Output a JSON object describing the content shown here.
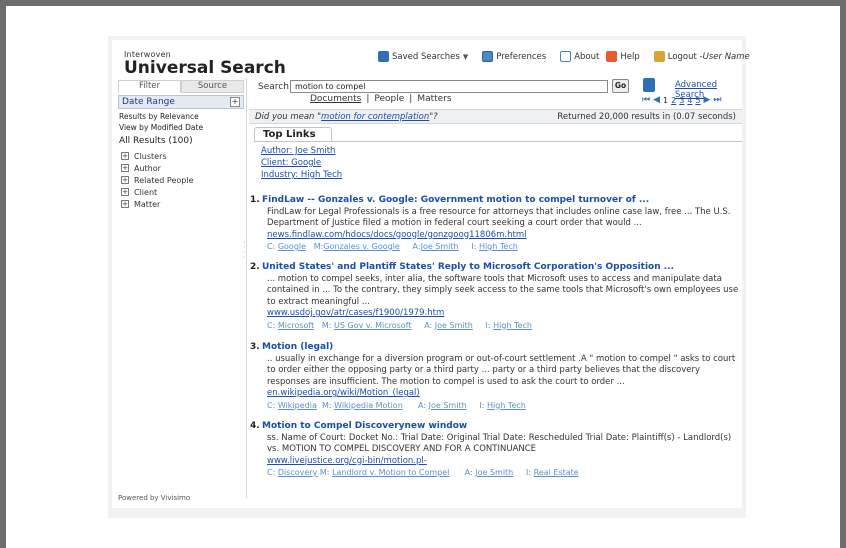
{
  "header": {
    "logo_small": "Interwoven",
    "logo_big": "Universal Search",
    "saved_searches": "Saved Searches",
    "preferences": "Preferences",
    "about": "About",
    "help": "Help",
    "logout": "Logout - ",
    "user_name": "User Name"
  },
  "sidebar": {
    "tabs": [
      "Filter",
      "Source"
    ],
    "date_range": "Date Range",
    "results_by_relevance": "Results by Relevance",
    "view_by_modified_date": "View by Modified Date",
    "all_results": "All Results (100)",
    "tree": [
      "Clusters",
      "Author",
      "Related People",
      "Client",
      "Matter"
    ],
    "powered_by": "Powered by Vivisimo"
  },
  "search": {
    "label": "Search:",
    "query": "motion to compel",
    "go": "Go",
    "advanced": "Advanced Search",
    "subtabs": [
      "Documents",
      "People",
      "Matters"
    ],
    "pages": [
      "1",
      "2",
      "3",
      "4",
      "5"
    ]
  },
  "didyoumean": {
    "prefix": "Did you mean \"",
    "suggestion": "motion for contemplation",
    "suffix": "\"?",
    "returned": "Returned 20,000 results in (0.07 seconds)"
  },
  "toplinks": {
    "title": "Top Links",
    "links": [
      "Author: Joe Smith",
      "Client: Google ",
      "Industry: High Tech"
    ]
  },
  "results": [
    {
      "num": "1.",
      "title": "FindLaw -- Gonzales v. Google: Government motion to compel turnover of ...",
      "desc": "FindLaw for Legal Professionals is a free resource for attorneys that includes online case law, free ... The U.S. Department of Justice filed a motion in federal court seeking a court order that would ...",
      "url": "news.findlaw.com/hdocs/docs/google/gonzgoog11806m.html",
      "client": "Google",
      "matter": "Gonzales v. Google",
      "author": "Joe Smith",
      "industry": "High Tech"
    },
    {
      "num": "2.",
      "title": "United States' and Plantiff States' Reply to Microsoft Corporation's Opposition ...",
      "desc": "... motion to compel seeks, inter alia, the software tools that Microsoft uses to access and manipulate data contained in ... To the contrary, they simply seek access to the same tools that Microsoft's own employees use to extract meaningful ...",
      "url": "www.usdoj.gov/atr/cases/f1900/1979.htm ",
      "client": "Microsoft",
      "matter": "US Gov v. Microsoft",
      "author": "Joe Smith",
      "industry": "High Tech"
    },
    {
      "num": "3.",
      "title": "Motion (legal)",
      "desc": ".. usually in exchange for a diversion program or out-of-court settlement .A \" motion to compel \" asks to court to order either the opposing party or a third party ... party or a third party believes that the discovery responses are insufficient. The motion to compel is used to ask the court to order ...",
      "url": "en.wikipedia.org/wiki/Motion_(legal)",
      "client": "Wikipedia",
      "matter": "Wikipedia Motion",
      "author": "Joe Smith",
      "industry": "High Tech"
    },
    {
      "num": "4.",
      "title": "Motion to Compel Discoverynew window",
      "desc": "ss. Name of Court: Docket No.: Trial Date: Original Trial Date: Rescheduled Trial Date: Plaintiff(s) - Landlord(s) vs. MOTION TO COMPEL DISCOVERY AND FOR A CONTINUANCE",
      "url": "www.livejustice.org/cgi-bin/motion.pl-",
      "client": "Discovery",
      "matter": "Landlord v. Motion to Compel",
      "author": "Joe Smith",
      "industry": "Real Estate"
    }
  ],
  "meta_labels": {
    "client": "C:",
    "matter": "M:",
    "author": "A:",
    "industry": "I:"
  }
}
